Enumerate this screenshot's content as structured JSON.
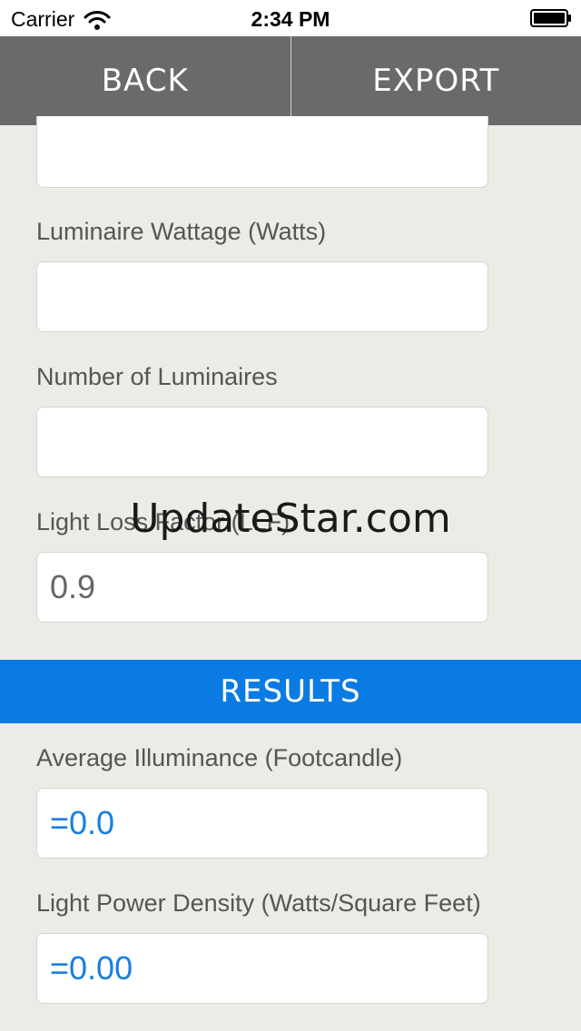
{
  "status_bar": {
    "carrier": "Carrier",
    "time": "2:34 PM"
  },
  "nav": {
    "back_label": "BACK",
    "export_label": "EXPORT"
  },
  "inputs": {
    "top_partial": {
      "value": ""
    },
    "luminaire_wattage": {
      "label": "Luminaire Wattage (Watts)",
      "value": ""
    },
    "number_of_luminaires": {
      "label": "Number of Luminaires",
      "value": ""
    },
    "light_loss_factor": {
      "label": "Light Loss Factor (LLF)",
      "value": "0.9"
    }
  },
  "results": {
    "header": "RESULTS",
    "average_illuminance": {
      "label": "Average Illuminance (Footcandle)",
      "value": "=0.0"
    },
    "light_power_density": {
      "label": "Light Power Density (Watts/Square Feet)",
      "value": "=0.00"
    }
  },
  "watermark": "UpdateStar.com",
  "colors": {
    "nav_bg": "#6a6a6a",
    "results_bar": "#0a7be3",
    "result_text": "#1a7fe0",
    "page_bg": "#ecebe6"
  },
  "icons": {
    "wifi": "wifi-icon",
    "battery": "battery-icon"
  }
}
